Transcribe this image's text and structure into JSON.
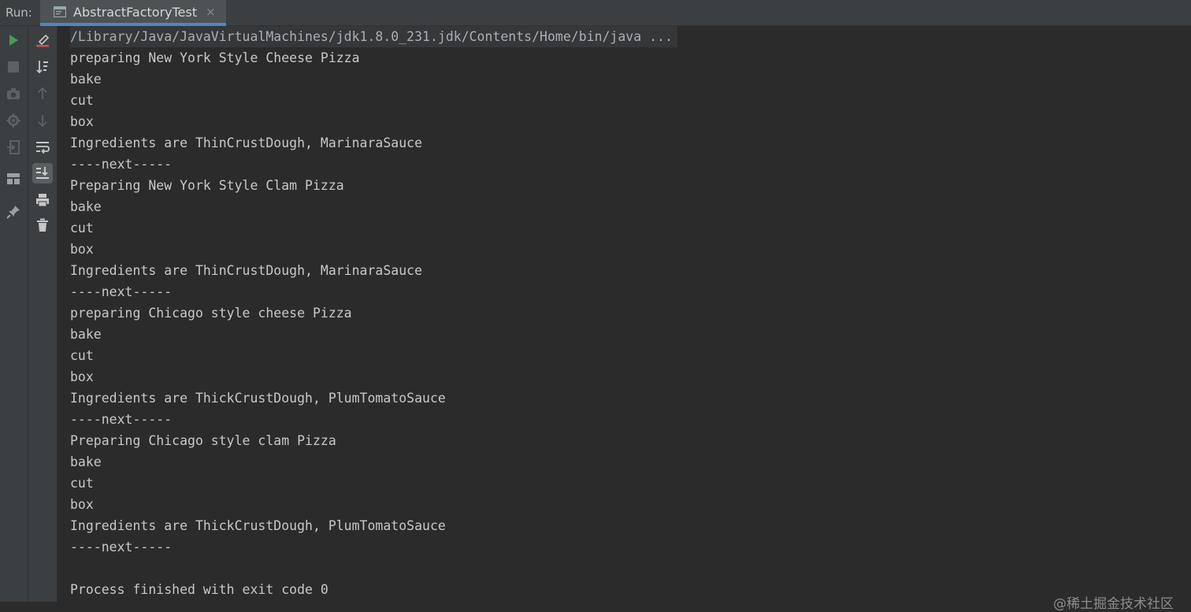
{
  "header": {
    "run_label": "Run:",
    "tab": {
      "title": "AbstractFactoryTest",
      "close": "×"
    }
  },
  "left_toolbar": [
    {
      "icon": "run-icon",
      "color": "#499c54"
    },
    {
      "icon": "stop-icon"
    },
    {
      "icon": "camera-icon"
    },
    {
      "icon": "settings-icon"
    },
    {
      "icon": "exit-icon"
    },
    {
      "icon": "layout-icon"
    },
    {
      "icon": "pin-icon"
    }
  ],
  "second_toolbar": [
    {
      "icon": "clear-icon"
    },
    {
      "icon": "sort-icon"
    },
    {
      "icon": "up-arrow-icon"
    },
    {
      "icon": "down-arrow-icon"
    },
    {
      "icon": "soft-wrap-icon"
    },
    {
      "icon": "scroll-to-end-icon",
      "active": true
    },
    {
      "icon": "print-icon"
    },
    {
      "icon": "trash-icon"
    }
  ],
  "console": {
    "lines": [
      "/Library/Java/JavaVirtualMachines/jdk1.8.0_231.jdk/Contents/Home/bin/java ...",
      "preparing New York Style Cheese Pizza",
      "bake",
      "cut",
      "box",
      "Ingredients are ThinCrustDough, MarinaraSauce",
      "----next-----",
      "Preparing New York Style Clam Pizza",
      "bake",
      "cut",
      "box",
      "Ingredients are ThinCrustDough, MarinaraSauce",
      "----next-----",
      "preparing Chicago style cheese Pizza",
      "bake",
      "cut",
      "box",
      "Ingredients are ThickCrustDough, PlumTomatoSauce",
      "----next-----",
      "Preparing Chicago style clam Pizza",
      "bake",
      "cut",
      "box",
      "Ingredients are ThickCrustDough, PlumTomatoSauce",
      "----next-----",
      "",
      "Process finished with exit code 0"
    ]
  },
  "watermark": "@稀土掘金技术社区"
}
